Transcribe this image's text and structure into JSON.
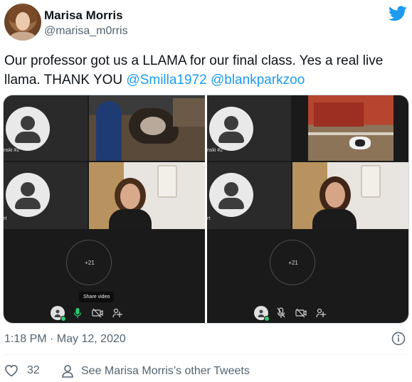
{
  "author": {
    "name": "Marisa Morris",
    "handle": "@marisa_m0rris"
  },
  "tweet": {
    "text_before": "Our professor got us a LLAMA for our final class. Yes a real live llama. THANK YOU ",
    "mention_1": "@Smilla1972",
    "text_between": " ",
    "mention_2": "@blankparkzoo"
  },
  "media": {
    "left": {
      "tile_label_1": "nski #2",
      "tile_label_2": "rt",
      "participant_count": "+21",
      "tooltip": "Share video"
    },
    "right": {
      "tile_label_1": "nski #2",
      "tile_label_2": "rt",
      "participant_count": "+21"
    }
  },
  "timestamp": "1:18 PM · May 12, 2020",
  "likes_count": "32",
  "profile_link": "See Marisa Morris’s other Tweets",
  "colors": {
    "accent": "#1d9bf0",
    "secondary_text": "#536471",
    "mic_active": "#2ecc71"
  },
  "icons": [
    "twitter-bird-icon",
    "info-icon",
    "heart-icon",
    "person-icon",
    "mic-icon",
    "video-off-icon",
    "share-screen-icon"
  ]
}
